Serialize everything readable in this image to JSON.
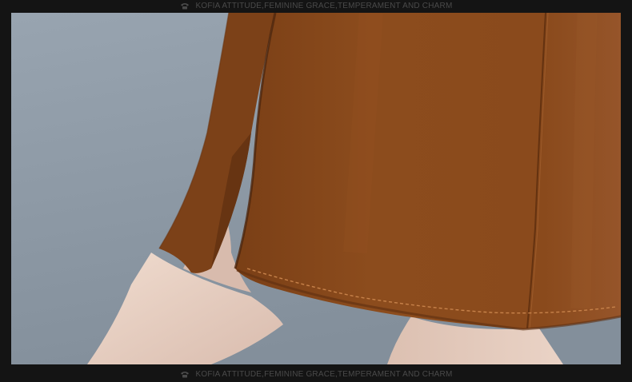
{
  "banner": {
    "top_text": "KOFIA ATTITUDE,FEMININE GRACE,TEMPERAMENT AND CHARM",
    "bottom_text": "KOFIA ATTITUDE,FEMININE GRACE,TEMPERAMENT AND CHARM",
    "icon": "telephone-icon"
  },
  "photo": {
    "subject": "skirt-hem-closeup",
    "colors": {
      "background": "#8e9aa6",
      "fabric": "#8a4a1c",
      "fabric_shadow": "#5e2f10",
      "skin": "#e8cfc2",
      "stitch": "#c7824a"
    }
  }
}
